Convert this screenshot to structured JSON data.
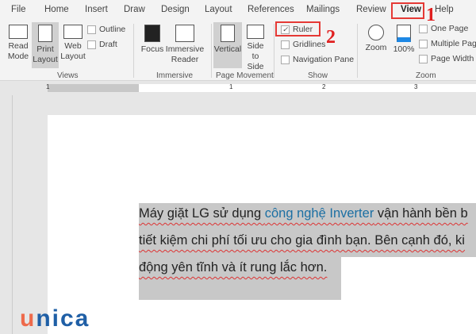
{
  "tabs": [
    "File",
    "Home",
    "Insert",
    "Draw",
    "Design",
    "Layout",
    "References",
    "Mailings",
    "Review",
    "View",
    "Help"
  ],
  "active_tab": "View",
  "groups": {
    "views": {
      "label": "Views",
      "read_mode": "Read Mode",
      "print_layout": "Print Layout",
      "web_layout": "Web Layout",
      "outline": "Outline",
      "draft": "Draft"
    },
    "immersive": {
      "label": "Immersive",
      "focus": "Focus",
      "reader": "Immersive Reader"
    },
    "page_movement": {
      "label": "Page Movement",
      "vertical": "Vertical",
      "side": "Side to Side"
    },
    "show": {
      "label": "Show",
      "ruler": "Ruler",
      "ruler_checked": true,
      "gridlines": "Gridlines",
      "gridlines_checked": false,
      "nav_pane": "Navigation Pane",
      "nav_pane_checked": false
    },
    "zoom": {
      "label": "Zoom",
      "zoom": "Zoom",
      "hundred": "100%",
      "one_page": "One Page",
      "multiple": "Multiple Pages",
      "width": "Page Width"
    }
  },
  "annotations": {
    "step1": "1",
    "step2": "2",
    "color": "#e53935"
  },
  "ruler_ticks": [
    "1",
    "1",
    "2",
    "3"
  ],
  "document": {
    "line1_a": "Máy giặt LG sử dụng ",
    "line1_link": "công nghệ Inverter",
    "line1_b": " vận hành bền b",
    "line2": "tiết kiệm chi phí tối ưu cho gia đình bạn. Bên cạnh đó, ki",
    "line3": "động yên tĩnh và ít rung lắc hơn."
  },
  "logo": "unica"
}
